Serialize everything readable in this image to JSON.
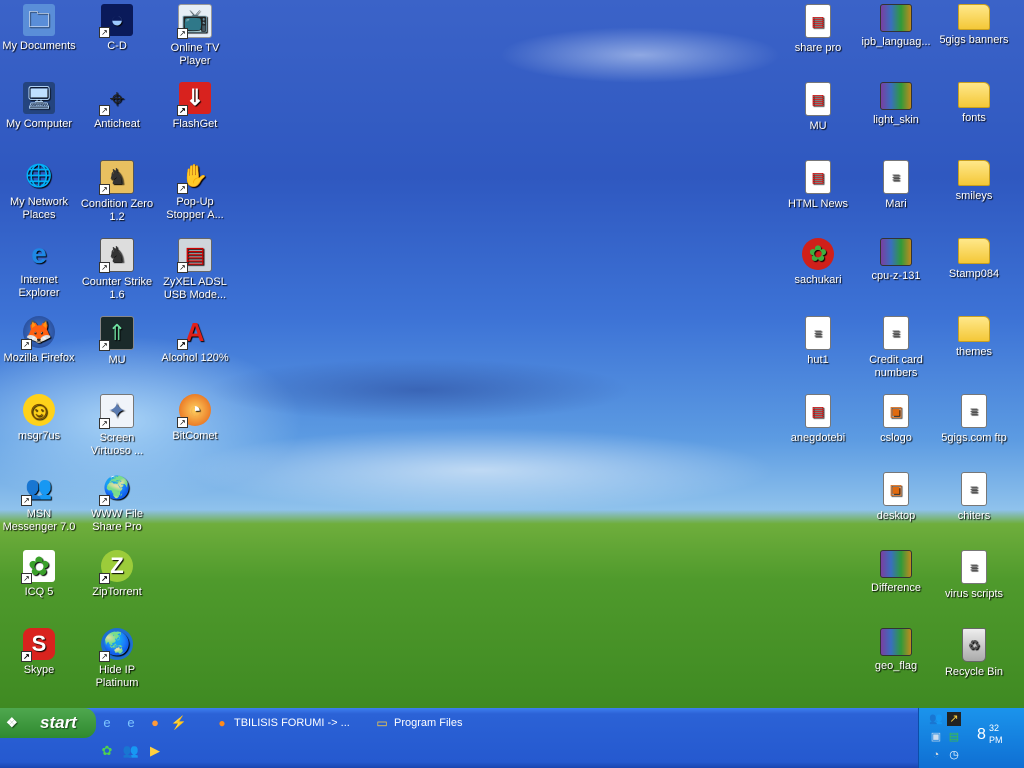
{
  "desktop": {
    "col1": [
      {
        "label": "My Documents",
        "icon": "my-documents-icon",
        "glyph": "🗀"
      },
      {
        "label": "My Computer",
        "icon": "my-computer-icon",
        "glyph": "🖥"
      },
      {
        "label": "My Network Places",
        "icon": "network-places-icon",
        "glyph": "🌐"
      },
      {
        "label": "Internet Explorer",
        "icon": "internet-explorer-icon",
        "glyph": "e"
      },
      {
        "label": "Mozilla Firefox",
        "icon": "firefox-icon",
        "glyph": "🦊"
      },
      {
        "label": "msgr7us",
        "icon": "messenger-smiley-icon",
        "glyph": "☺"
      },
      {
        "label": "MSN Messenger 7.0",
        "icon": "msn-messenger-icon",
        "glyph": "👥"
      },
      {
        "label": "ICQ 5",
        "icon": "icq-flower-icon",
        "glyph": "✿"
      },
      {
        "label": "Skype",
        "icon": "skype-icon",
        "glyph": "S"
      }
    ],
    "col2": [
      {
        "label": "C-D",
        "icon": "cd-icon",
        "glyph": "◒"
      },
      {
        "label": "Anticheat",
        "icon": "anticheat-icon",
        "glyph": "⌖"
      },
      {
        "label": "Condition Zero 1.2",
        "icon": "condition-zero-icon",
        "glyph": "♞"
      },
      {
        "label": "Counter Strike 1.6",
        "icon": "counter-strike-icon",
        "glyph": "♞"
      },
      {
        "label": "MU",
        "icon": "mu-icon",
        "glyph": "⇑"
      },
      {
        "label": "Screen Virtuoso ...",
        "icon": "screen-virtuoso-icon",
        "glyph": "✦"
      },
      {
        "label": "WWW File Share Pro",
        "icon": "file-share-icon",
        "glyph": "🌍"
      },
      {
        "label": "ZipTorrent",
        "icon": "ziptorrent-icon",
        "glyph": "Z"
      },
      {
        "label": "Hide IP Platinum",
        "icon": "hide-ip-icon",
        "glyph": "🌏"
      }
    ],
    "col3": [
      {
        "label": "Online TV Player",
        "icon": "online-tv-icon",
        "glyph": "📺"
      },
      {
        "label": "FlashGet",
        "icon": "flashget-icon",
        "glyph": "⇓"
      },
      {
        "label": "Pop-Up Stopper A...",
        "icon": "popup-stopper-icon",
        "glyph": "✋"
      },
      {
        "label": "ZyXEL ADSL USB Mode...",
        "icon": "zyxel-modem-icon",
        "glyph": "▤"
      },
      {
        "label": "Alcohol 120%",
        "icon": "alcohol-icon",
        "glyph": "A"
      },
      {
        "label": "BitComet",
        "icon": "bitcomet-icon",
        "glyph": "◔"
      }
    ],
    "col_right1": [
      {
        "label": "share pro",
        "icon": "document-icon"
      },
      {
        "label": "MU",
        "icon": "document-icon"
      },
      {
        "label": "HTML News",
        "icon": "document-icon"
      },
      {
        "label": "sachukari",
        "icon": "gift-icon"
      },
      {
        "label": "hut1",
        "icon": "text-file-icon"
      },
      {
        "label": "anegdotebi",
        "icon": "document-icon"
      }
    ],
    "col_right2": [
      {
        "label": "ipb_languag...",
        "icon": "rar-archive-icon"
      },
      {
        "label": "light_skin",
        "icon": "rar-archive-icon"
      },
      {
        "label": "Mari",
        "icon": "text-file-icon"
      },
      {
        "label": "cpu-z-131",
        "icon": "rar-archive-icon"
      },
      {
        "label": "Credit card numbers",
        "icon": "text-file-icon"
      },
      {
        "label": "cslogo",
        "icon": "image-file-icon"
      },
      {
        "label": "desktop",
        "icon": "image-file-icon"
      },
      {
        "label": "Difference",
        "icon": "rar-archive-icon"
      },
      {
        "label": "geo_flag",
        "icon": "rar-archive-icon"
      }
    ],
    "col_right3": [
      {
        "label": "5gigs banners",
        "icon": "folder-icon"
      },
      {
        "label": "fonts",
        "icon": "folder-icon"
      },
      {
        "label": "smileys",
        "icon": "folder-icon"
      },
      {
        "label": "Stamp084",
        "icon": "folder-icon"
      },
      {
        "label": "themes",
        "icon": "folder-icon"
      },
      {
        "label": "5gigs.com ftp",
        "icon": "text-file-icon"
      },
      {
        "label": "chiters",
        "icon": "text-file-icon"
      },
      {
        "label": "virus scripts",
        "icon": "text-file-icon"
      },
      {
        "label": "Recycle Bin",
        "icon": "recycle-bin-icon"
      }
    ]
  },
  "taskbar": {
    "start_label": "start",
    "quick_launch": [
      "ie-quicklaunch-icon",
      "ie-quicklaunch-icon",
      "firefox-quicklaunch-icon",
      "winamp-quicklaunch-icon",
      "icq-quicklaunch-icon",
      "msn-quicklaunch-icon",
      "media-player-quicklaunch-icon"
    ],
    "tasks": [
      {
        "label": "TBILISIS FORUMI -> ...",
        "icon": "firefox-icon"
      },
      {
        "label": "Program Files",
        "icon": "folder-icon"
      }
    ],
    "clock": {
      "hour": "8",
      "minute": "32",
      "ampm": "PM"
    }
  }
}
